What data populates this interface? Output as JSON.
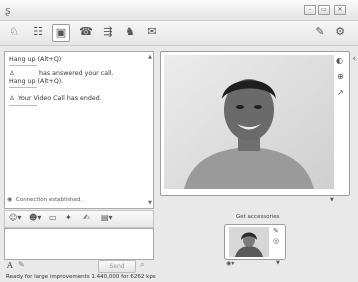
{
  "titlebar": {
    "minimize_label": "–",
    "maximize_label": "▭",
    "close_label": "✕"
  },
  "chat": {
    "messages": [
      {
        "text": "Hang up (Alt+Q)"
      },
      {
        "text": "has answered your call."
      },
      {
        "text": "Hang up (Alt+Q)."
      },
      {
        "text": "Your Video Call has ended."
      }
    ],
    "connection_status": "Connection established."
  },
  "composer": {
    "send_label": "Send",
    "format_font_label": "A"
  },
  "video": {
    "get_accessories_label": "Get accessories"
  },
  "statusbar": {
    "text": "Ready for large improvements 1.440,000 for 6262 kps"
  },
  "icons": {
    "toolbar": [
      "webcam-icon",
      "contacts-icon",
      "video-call-icon",
      "phone-icon",
      "share-icon",
      "games-icon",
      "send-file-icon"
    ],
    "formatting": [
      "emoticon-icon",
      "wink-icon",
      "voice-clip-icon",
      "nudge-icon",
      "ink-icon",
      "background-icon"
    ]
  },
  "colors": {
    "background": "#e9e9e9",
    "pane_border": "#aaaaaa"
  }
}
